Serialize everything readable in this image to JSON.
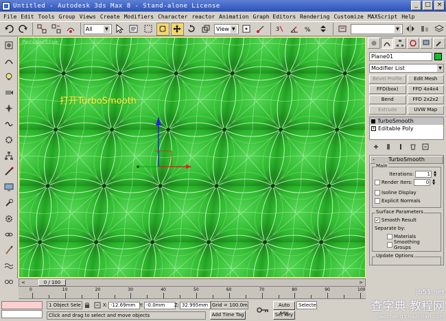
{
  "window": {
    "title": "Untitled - Autodesk 3ds Max 8  - Stand-alone License"
  },
  "menu": [
    "File",
    "Edit",
    "Tools",
    "Group",
    "Views",
    "Create",
    "Modifiers",
    "Character",
    "reactor",
    "Animation",
    "Graph Editors",
    "Rendering",
    "Customize",
    "MAXScript",
    "Help"
  ],
  "toolbar": {
    "selection_filter": "All",
    "ref_coord": "View"
  },
  "viewport": {
    "label": "Perspective",
    "annotation": "打开TurboSmooth"
  },
  "command_panel": {
    "object_name": "Plane01",
    "object_color": "#0fbf2f",
    "modifier_list": "Modifier List",
    "modifier_buttons": [
      {
        "label": "Bevel Profile",
        "enabled": false
      },
      {
        "label": "Edit Mesh",
        "enabled": true
      },
      {
        "label": "FFD(box)",
        "enabled": true
      },
      {
        "label": "FFD 4x4x4",
        "enabled": true
      },
      {
        "label": "Bend",
        "enabled": true
      },
      {
        "label": "FFD 2x2x2",
        "enabled": true
      },
      {
        "label": "Extrude",
        "enabled": false
      },
      {
        "label": "UVW Map",
        "enabled": true
      }
    ],
    "stack": [
      {
        "label": "TurboSmooth",
        "selected": true
      },
      {
        "label": "Editable Poly",
        "selected": false
      }
    ],
    "rollout": {
      "title": "TurboSmooth",
      "main_group": "Main",
      "iterations_label": "Iterations:",
      "iterations_value": "1",
      "render_iters_label": "Render Iters:",
      "render_iters_value": "0",
      "isoline_label": "Isoline Display",
      "explicit_label": "Explicit Normals",
      "surface_group": "Surface Parameters",
      "smooth_result_label": "Smooth Result",
      "separate_by_label": "Separate by:",
      "materials_label": "Materials",
      "smoothing_label": "Smoothing Groups",
      "update_group": "Update Options"
    }
  },
  "timeline": {
    "position": "0 / 100",
    "ticks": [
      "0",
      "10",
      "20",
      "30",
      "40",
      "50",
      "60",
      "70",
      "80",
      "90",
      "100"
    ]
  },
  "status": {
    "selection": "1 Object Sele",
    "x_label": "X:",
    "x_value": "-12.69mm",
    "y_label": "Y:",
    "y_value": "-0.0mm",
    "z_label": "Z:",
    "z_value": "32.995mm",
    "grid": "Grid = 100.0mm",
    "auto_key": "Auto Key",
    "selected": "Selecte",
    "set_key": "Set Key",
    "prompt": "Click and drag to select and move objects",
    "add_time_tag": "Add Time Tag"
  },
  "watermark": {
    "line1": "jb51.net",
    "line2": "查字典 教程网",
    "line3": "jiaocheng.chazidian.com"
  }
}
